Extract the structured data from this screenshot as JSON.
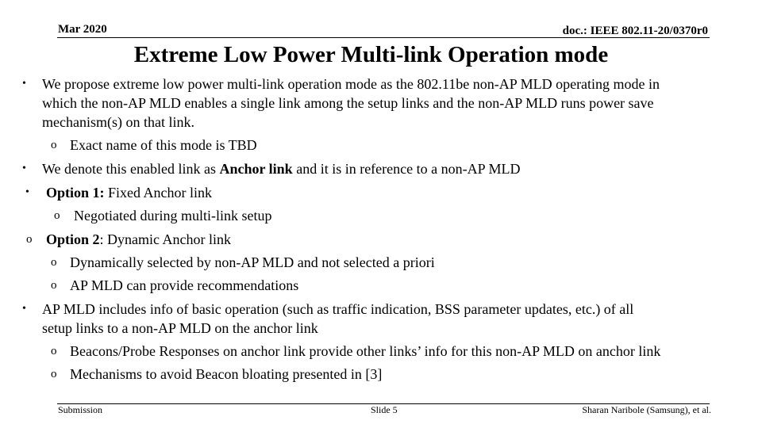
{
  "header": {
    "date": "Mar 2020",
    "doc_id": "doc.: IEEE 802.11-20/0370r0"
  },
  "title": "Extreme Low Power Multi-link Operation mode",
  "bullet_glyph": "•",
  "sub_bullet_glyph": "o",
  "body": {
    "b1_l1": "We propose extreme low power multi-link operation mode as the 802.11be non-AP MLD operating mode in",
    "b1_l2": "which the non-AP MLD enables a single link among the setup links and the non-AP MLD runs power save",
    "b1_l3": "mechanism(s) on that link.",
    "b1_sub1": "Exact name of this mode is TBD",
    "b2_pre": "We denote this enabled link as ",
    "b2_bold": "Anchor link",
    "b2_post": " and it is in reference to a non-AP MLD",
    "b3_bold": "Option 1:",
    "b3_text": " Fixed Anchor link",
    "b3_sub1": "Negotiated during multi-link setup",
    "b4_bold": "Option 2",
    "b4_text": ": Dynamic Anchor link",
    "b4_sub1": "Dynamically selected by non-AP MLD and not selected a priori",
    "b4_sub2": "AP MLD can provide recommendations",
    "b5_l1": "AP MLD includes info of basic operation (such as traffic indication, BSS parameter updates, etc.) of all",
    "b5_l2": "setup links to a non-AP MLD on the anchor link",
    "b5_sub1": "Beacons/Probe Responses on anchor link provide other links’ info for this non-AP MLD on anchor link",
    "b5_sub2": "Mechanisms to avoid Beacon bloating presented in [3]"
  },
  "footer": {
    "left": "Submission",
    "center": "Slide 5",
    "right": "Sharan Naribole (Samsung), et al."
  }
}
